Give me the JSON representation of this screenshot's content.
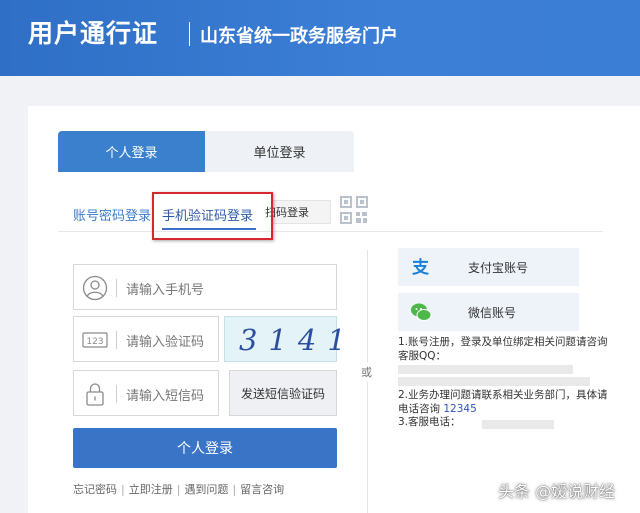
{
  "header": {
    "title": "用户通行证",
    "subtitle": "山东省统一政务服务门户"
  },
  "tabs": [
    {
      "label": "个人登录",
      "active": true
    },
    {
      "label": "单位登录",
      "active": false
    }
  ],
  "login_methods": {
    "account_password": "账号密码登录",
    "sms_code": "手机验证码登录",
    "scan_code": "扫码登录"
  },
  "form": {
    "phone_placeholder": "请输入手机号",
    "code_placeholder": "请输入验证码",
    "sms_placeholder": "请输入短信码",
    "captcha_text": "3141",
    "send_sms_button": "发送短信验证码",
    "login_button": "个人登录"
  },
  "links": {
    "forgot_password": "忘记密码",
    "register": "立即注册",
    "problem": "遇到问题",
    "message": "留言咨询"
  },
  "divider_or": "或",
  "third_party": {
    "alipay": "支付宝账号",
    "wechat": "微信账号"
  },
  "notes": {
    "line1": "1.账号注册，登录及单位绑定相关问题请咨询客服QQ：",
    "line2": "2.业务办理问题请联系相关业务部门，具体请电话咨询",
    "line2_number": "12345",
    "line3": "3.客服电话："
  },
  "watermark": "头条 @嫒说财经",
  "colors": {
    "header_blue": "#3a7bd5",
    "tab_active": "#3b80cc",
    "login_button": "#3a74c6",
    "highlight_red": "#d9262f"
  }
}
